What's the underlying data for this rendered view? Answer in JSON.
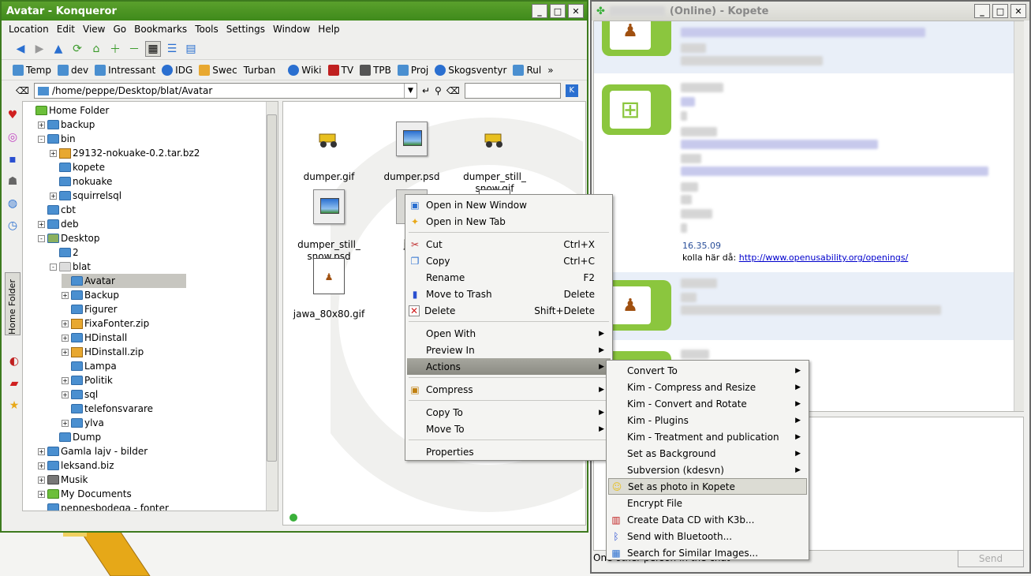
{
  "konqueror": {
    "title": "Avatar - Konqueror",
    "menu": [
      "Location",
      "Edit",
      "View",
      "Go",
      "Bookmarks",
      "Tools",
      "Settings",
      "Window",
      "Help"
    ],
    "bookmarks": [
      "Temp",
      "dev",
      "Intressant",
      "IDG",
      "Swec",
      "Turban",
      "Wiki",
      "TV",
      "TPB",
      "Proj",
      "Skogsventyr",
      "Rul"
    ],
    "location": "/home/peppe/Desktop/blat/Avatar",
    "sidebar_tab": "Home Folder",
    "tree": [
      {
        "label": "Home Folder"
      },
      {
        "label": "backup"
      },
      {
        "label": "bin"
      },
      {
        "label": "29132-nokuake-0.2.tar.bz2"
      },
      {
        "label": "kopete"
      },
      {
        "label": "nokuake"
      },
      {
        "label": "squirrelsql"
      },
      {
        "label": "cbt"
      },
      {
        "label": "deb"
      },
      {
        "label": "Desktop"
      },
      {
        "label": "2"
      },
      {
        "label": "blat"
      },
      {
        "label": "Avatar"
      },
      {
        "label": "Backup"
      },
      {
        "label": "Figurer"
      },
      {
        "label": "FixaFonter.zip"
      },
      {
        "label": "HDinstall"
      },
      {
        "label": "HDinstall.zip"
      },
      {
        "label": "Lampa"
      },
      {
        "label": "Politik"
      },
      {
        "label": "sql"
      },
      {
        "label": "telefonsvarare"
      },
      {
        "label": "ylva"
      },
      {
        "label": "Dump"
      },
      {
        "label": "Gamla lajv - bilder"
      },
      {
        "label": "leksand.biz"
      },
      {
        "label": "Musik"
      },
      {
        "label": "My Documents"
      },
      {
        "label": "peppesbodega - fonter"
      }
    ],
    "files": [
      {
        "name": "dumper.gif"
      },
      {
        "name": "dumper.psd"
      },
      {
        "name": "dumper_still_\nsnow.gif"
      },
      {
        "name": "dumper_still_\nsnow.psd"
      },
      {
        "name": "jaw"
      },
      {
        "name": ""
      },
      {
        "name": "jawa_80x80.gif"
      }
    ]
  },
  "context_menu": [
    {
      "label": "Open in New Window",
      "shortcut": ""
    },
    {
      "label": "Open in New Tab",
      "shortcut": ""
    },
    {
      "label": "Cut",
      "shortcut": "Ctrl+X"
    },
    {
      "label": "Copy",
      "shortcut": "Ctrl+C"
    },
    {
      "label": "Rename",
      "shortcut": "F2"
    },
    {
      "label": "Move to Trash",
      "shortcut": "Delete"
    },
    {
      "label": "Delete",
      "shortcut": "Shift+Delete"
    },
    {
      "label": "Open With",
      "shortcut": ""
    },
    {
      "label": "Preview In",
      "shortcut": ""
    },
    {
      "label": "Actions",
      "shortcut": ""
    },
    {
      "label": "Compress",
      "shortcut": ""
    },
    {
      "label": "Copy To",
      "shortcut": ""
    },
    {
      "label": "Move To",
      "shortcut": ""
    },
    {
      "label": "Properties",
      "shortcut": ""
    }
  ],
  "actions_submenu": [
    "Convert To",
    "Kim - Compress and Resize",
    "Kim - Convert and Rotate",
    "Kim - Plugins",
    "Kim - Treatment and publication",
    "Set as Background",
    "Subversion (kdesvn)",
    "Set as photo in Kopete",
    "Encrypt File",
    "Create Data CD with K3b...",
    "Send with Bluetooth...",
    "Search for Similar Images..."
  ],
  "kopete": {
    "title": "(Online) - Kopete",
    "msg_time": "16.35.09",
    "msg_text": "kolla här då: ",
    "msg_link": "http://www.openusability.org/openings/",
    "status": "One other person in the chat",
    "send": "Send"
  },
  "colors": {
    "konq_title": "#3f8a1b",
    "kopete_green": "#8bc63e",
    "link": "#0000cc",
    "menu_hl": "#9a9a92"
  }
}
